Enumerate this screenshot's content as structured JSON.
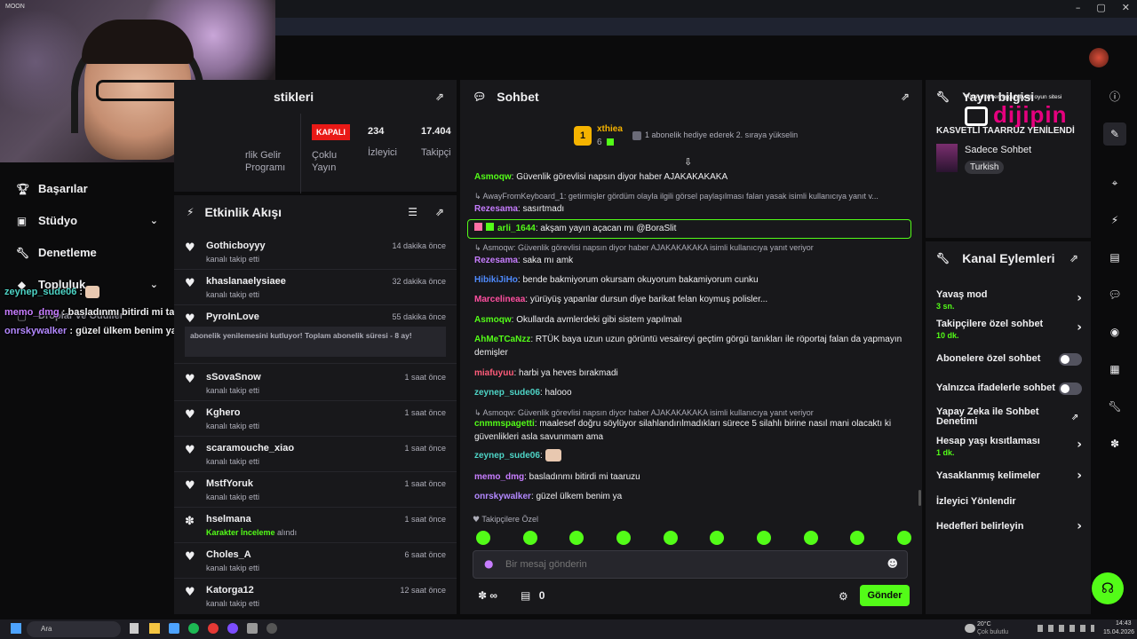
{
  "webcam": {
    "label": "MOON"
  },
  "leftnav": {
    "items": [
      {
        "label": "Başarılar",
        "icon": "trophy-icon"
      },
      {
        "label": "Stüdyo",
        "icon": "studio-icon"
      },
      {
        "label": "Denetleme",
        "icon": "wrench-icon"
      },
      {
        "label": "Topluluk",
        "icon": "community-icon"
      },
      {
        "label": "Droplar ve Ödüller",
        "icon": "gift-icon"
      }
    ]
  },
  "overlay_chat": [
    {
      "user": "zeynep_sude06",
      "sep": " :",
      "text": "",
      "color": "#4ed4c6"
    },
    {
      "user": "memo_dmg",
      "sep": " :",
      "text": " basladınmı bitirdi mi taaruzu",
      "color": "#c77dff"
    },
    {
      "user": "onrskywalker",
      "sep": " :",
      "text": " güzel ülkem benim ya",
      "color": "#b388ff"
    }
  ],
  "stats": {
    "title": "stikleri",
    "cols": [
      {
        "top": "",
        "bottom": "rlik Gelir Programı"
      },
      {
        "top": "KAPALI",
        "bottom": "Çoklu Yayın"
      },
      {
        "top": "234",
        "bottom": "İzleyici"
      },
      {
        "top": "17.404",
        "bottom": "Takipçi"
      }
    ]
  },
  "activity": {
    "title": "Etkinlik Akışı",
    "items": [
      {
        "name": "Gothicboyyy",
        "sub": "kanalı takip etti",
        "time": "14 dakika önce",
        "icon": "heart-icon"
      },
      {
        "name": "khaslanaelysiaee",
        "sub": "kanalı takip etti",
        "time": "32 dakika önce",
        "icon": "heart-icon"
      },
      {
        "name": "PyroInLove",
        "sub": "abonelik yenilemesini kutluyor! Toplam abonelik süresi - 8 ay!",
        "time": "55 dakika önce",
        "icon": "heart-icon"
      },
      {
        "name": "sSovaSnow",
        "sub": "kanalı takip etti",
        "time": "1 saat önce",
        "icon": "heart-icon"
      },
      {
        "name": "Kghero",
        "sub": "kanalı takip etti",
        "time": "1 saat önce",
        "icon": "heart-icon"
      },
      {
        "name": "scaramouche_xiao",
        "sub": "kanalı takip etti",
        "time": "1 saat önce",
        "icon": "heart-icon"
      },
      {
        "name": "MstfYoruk",
        "sub": "kanalı takip etti",
        "time": "1 saat önce",
        "icon": "heart-icon"
      },
      {
        "name": "hselmana",
        "sub_green": "Karakter İnceleme",
        "sub": " alındı",
        "time": "1 saat önce",
        "icon": "gift-icon"
      },
      {
        "name": "Choles_A",
        "sub": "kanalı takip etti",
        "time": "6 saat önce",
        "icon": "heart-icon"
      },
      {
        "name": "Katorga12",
        "sub": "kanalı takip etti",
        "time": "12 saat önce",
        "icon": "heart-icon"
      }
    ]
  },
  "chat": {
    "title": "Sohbet",
    "pinned": {
      "user": "xthiea",
      "count": "6",
      "rank": "1",
      "text": "1 abonelik hediye ederek 2. sıraya yükselin"
    },
    "lines": [
      {
        "user": "Asmoqw",
        "color": "#53fc18",
        "text": " Güvenlik görevlisi napsın diyor haber AJAKAKAKAKA"
      },
      {
        "reply": "AwayFromKeyboard_1: getirmişler gördüm olayla ilgili görsel paylaşılması falan yasak isimli kullanıcıya yanıt v..."
      },
      {
        "user": "Rezesama",
        "color": "#c77dff",
        "text": " sasırtmadı"
      },
      {
        "user": "arli_1644",
        "color": "#53fc18",
        "text": " akşam yayın açacan mı @BoraSlit",
        "highlight": true
      },
      {
        "reply": "Asmoqw: Güvenlik görevlisi napsın diyor haber AJAKAKAKAKA isimli kullanıcıya yanıt veriyor"
      },
      {
        "user": "Rezesama",
        "color": "#c77dff",
        "text": " saka mı amk"
      },
      {
        "user": "HibikiJiHo",
        "color": "#4f8bff",
        "text": " bende bakmiyorum okursam okuyorum bakamiyorum cunku"
      },
      {
        "user": "Marcelineaa",
        "color": "#ff4fa0",
        "text": " yürüyüş yapanlar dursun diye barikat felan koymuş polisler..."
      },
      {
        "user": "Asmoqw",
        "color": "#53fc18",
        "text": " Okullarda avmlerdeki gibi sistem yapılmalı"
      },
      {
        "user": "AhMeTCaNzz",
        "color": "#53fc18",
        "text": " RTÜK baya uzun uzun görüntü vesaireyi geçtim görgü tanıkları ile röportaj falan da yapmayın demişler"
      },
      {
        "user": "miafuyuu",
        "color": "#ff5c7a",
        "text": " harbi ya heves bırakmadi"
      },
      {
        "user": "zeynep_sude06",
        "color": "#4ed4c6",
        "text": " halooo"
      },
      {
        "reply": "Asmoqw: Güvenlik görevlisi napsın diyor haber AJAKAKAKAKA isimli kullanıcıya yanıt veriyor"
      },
      {
        "user": "cnmmspagetti",
        "color": "#53fc18",
        "text": " maalesef doğru söylüyor silahlandırılmadıkları sürece 5 silahlı birine nasıl mani olacaktı ki güvenlikleri asla savunmam ama"
      },
      {
        "user": "zeynep_sude06",
        "color": "#4ed4c6",
        "text": ""
      },
      {
        "user": "memo_dmg",
        "color": "#c77dff",
        "text": " basladınmı bitirdi mi taaruzu"
      },
      {
        "user": "onrskywalker",
        "color": "#b388ff",
        "text": " güzel ülkem benim ya"
      }
    ],
    "followers_only": "Takipçilere Özel",
    "input_placeholder": "Bir mesaj gönderin",
    "points": "∞",
    "store_count": "0",
    "send_label": "Gönder"
  },
  "stream_info": {
    "title": "Yayın bilgisi",
    "headline": "KASVETLİ TAARRUZ YENİLENDİ",
    "category": "Sadece Sohbet",
    "tag": "Turkish",
    "ad_small": "Türkiye'nin en uygun fiyatlı oyun sitesi",
    "ad_brand": "dijipin"
  },
  "channel_actions": {
    "title": "Kanal Eylemleri",
    "rows": [
      {
        "label": "Yavaş mod",
        "sub": "3 sn.",
        "control": "arrow"
      },
      {
        "label": "Takipçilere özel sohbet",
        "sub": "10 dk.",
        "control": "arrow"
      },
      {
        "label": "Abonelere özel sohbet",
        "sub": "",
        "control": "toggle"
      },
      {
        "label": "Yalnızca ifadelerle sohbet",
        "sub": "",
        "control": "toggle"
      },
      {
        "label": "Yapay Zeka ile Sohbet Denetimi",
        "sub": "",
        "control": "external"
      },
      {
        "label": "Hesap yaşı kısıtlaması",
        "sub": "1 dk.",
        "control": "arrow"
      },
      {
        "label": "Yasaklanmış kelimeler",
        "sub": "",
        "control": "arrow"
      },
      {
        "label": "İzleyici Yönlendir",
        "sub": "",
        "control": "none"
      },
      {
        "label": "Hedefleri belirleyin",
        "sub": "",
        "control": "arrow"
      }
    ]
  },
  "taskbar": {
    "search": "Ara",
    "weather": "20°C",
    "weather_sub": "Çok bulutlu",
    "time": "14:43",
    "date": "15.04.2026"
  },
  "colors": {
    "accent": "#53fc18",
    "panel": "#18181b",
    "bg": "#0b0b0c"
  }
}
